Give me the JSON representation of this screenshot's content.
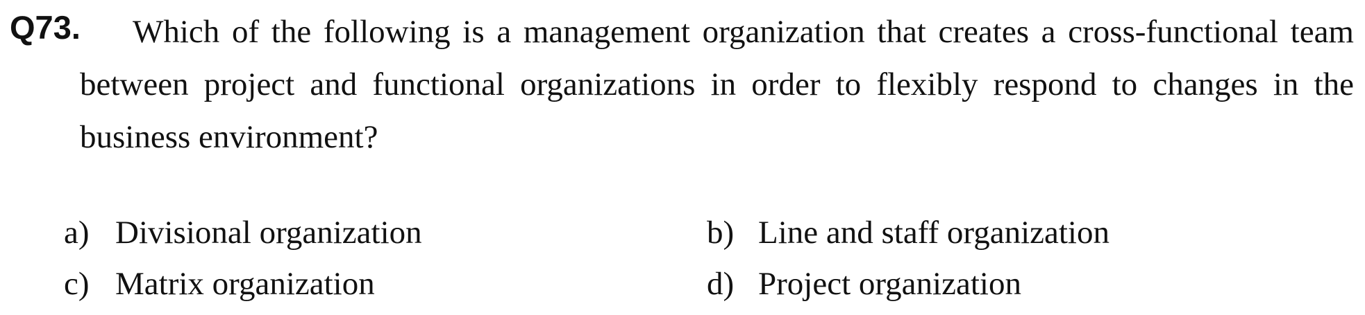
{
  "question": {
    "number": "Q73.",
    "text": "Which of the following is a management organization that creates a cross-functional team between project and functional organizations in order to flexibly respond to changes in the business environment?"
  },
  "choices": [
    {
      "letter": "a)",
      "text": "Divisional organization"
    },
    {
      "letter": "b)",
      "text": "Line and staff organization"
    },
    {
      "letter": "c)",
      "text": "Matrix organization"
    },
    {
      "letter": "d)",
      "text": "Project organization"
    }
  ]
}
